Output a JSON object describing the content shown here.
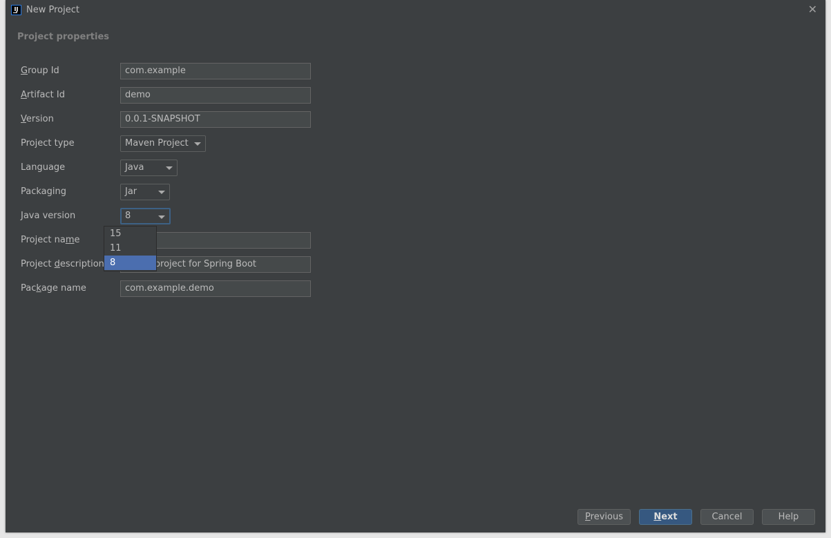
{
  "window": {
    "title": "New Project",
    "app_icon": "intellij-icon",
    "close_icon": "close-icon"
  },
  "section_title": "Project properties",
  "fields": {
    "group_id": {
      "label_mn": "G",
      "label_rest": "roup Id",
      "value": "com.example"
    },
    "artifact_id": {
      "label_mn": "A",
      "label_rest": "rtifact Id",
      "value": "demo"
    },
    "version": {
      "label_mn": "V",
      "label_rest": "ersion",
      "value": "0.0.1-SNAPSHOT"
    },
    "project_type": {
      "label": "Project type",
      "value": "Maven Project"
    },
    "language": {
      "label": "Language",
      "value": "Java"
    },
    "packaging": {
      "label": "Packaging",
      "value": "Jar"
    },
    "java_version": {
      "label": "Java version",
      "value": "8",
      "options": [
        "15",
        "11",
        "8"
      ],
      "selected": "8"
    },
    "project_name": {
      "label_pre": "Project na",
      "label_mn": "m",
      "label_rest": "e",
      "value": ""
    },
    "project_description": {
      "label_pre": "Project ",
      "label_mn": "d",
      "label_rest": "escription",
      "value": "Demo project for Spring Boot"
    },
    "package_name": {
      "label_pre": "Pac",
      "label_mn": "k",
      "label_rest": "age name",
      "value": "com.example.demo"
    }
  },
  "buttons": {
    "previous": {
      "mn": "P",
      "rest": "revious"
    },
    "next": {
      "mn": "N",
      "rest": "ext"
    },
    "cancel": "Cancel",
    "help": "Help"
  },
  "colors": {
    "background": "#3c3f41",
    "accent": "#365880",
    "selection": "#4b6eaf"
  }
}
